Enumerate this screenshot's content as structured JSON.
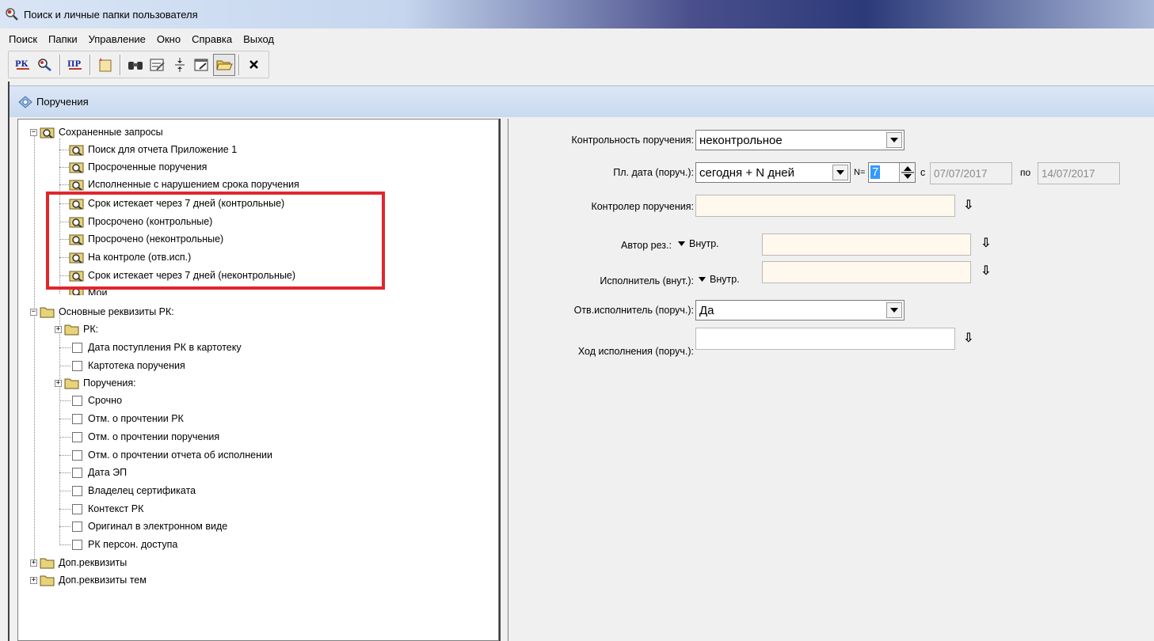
{
  "window": {
    "title": "Поиск и личные папки пользователя"
  },
  "menu": [
    "Поиск",
    "Папки",
    "Управление",
    "Окно",
    "Справка",
    "Выход"
  ],
  "toolbar": {
    "rk_label": "РК",
    "pr_label": "ПР"
  },
  "subwindow": {
    "title": "Поручения"
  },
  "tree": {
    "saved_queries": "Сохраненные запросы",
    "queries": [
      "Поиск для отчета Приложение 1",
      "Просроченные поручения",
      "Исполненные с нарушением срока поручения",
      "Срок истекает через 7 дней (контрольные)",
      "Просрочено (контрольные)",
      "Просрочено (неконтрольные)",
      "На контроле (отв.исп.)",
      "Срок истекает через 7 дней (неконтрольные)",
      "Мои"
    ],
    "main_attrs": "Основные реквизиты РК:",
    "attrs": [
      "РК:",
      "Дата поступления РК в картотеку",
      "Картотека поручения",
      "Поручения:",
      "Срочно",
      "Отм. о прочтении РК",
      "Отм. о прочтении поручения",
      "Отм. о прочтении отчета об исполнении",
      "Дата ЭП",
      "Владелец сертификата",
      "Контекст РК",
      "Оригинал в электронном виде",
      "РК персон. доступа"
    ],
    "extra": "Доп.реквизиты",
    "extra_topics": "Доп.реквизиты тем",
    "expand_plus": "+",
    "expand_minus": "−"
  },
  "form": {
    "control_label": "Контрольность поручения:",
    "control_value": "неконтрольное",
    "date_label": "Пл. дата (поруч.):",
    "date_value": "сегодня + N дней",
    "n_label": "N=",
    "n_value": "7",
    "from_label": "с",
    "from_date": "07/07/2017",
    "to_label": "по",
    "to_date": "14/07/2017",
    "controller_label": "Контролер поручения:",
    "author_label": "Автор рез.:",
    "author_scope": "Внутр.",
    "executor_label": "Исполнитель (внут.):",
    "executor_scope": "Внутр.",
    "resp_label": "Отв.исполнитель (поруч.):",
    "resp_value": "Да",
    "progress_label": "Ход исполнения (поруч.):"
  },
  "colors": {
    "highlight": "#e0262d",
    "input_bg": "#fff8ec",
    "selected_bg": "#3399ff"
  }
}
